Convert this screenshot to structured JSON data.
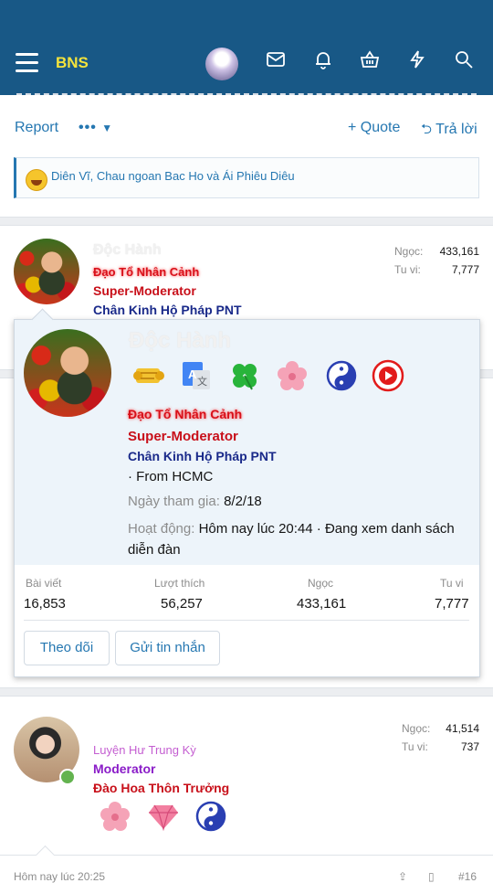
{
  "header": {
    "brand": "BNS",
    "icons": [
      "menu-icon",
      "avatar",
      "mail-icon",
      "bell-icon",
      "basket-icon",
      "bolt-icon",
      "search-icon"
    ]
  },
  "post_actions": {
    "report": "Report",
    "more": "•••",
    "quote": "+ Quote",
    "reply": "Trả lời"
  },
  "reactions": {
    "text": "Diên Vĩ, Chau ngoan Bac Ho và Ái Phiêu Diêu"
  },
  "post1": {
    "username": "Độc Hành",
    "title": "Đạo Tổ Nhân Cảnh",
    "role": "Super-Moderator",
    "group": "Chân Kinh Hộ Pháp PNT",
    "stats": [
      {
        "label": "Ngọc:",
        "value": "433,161"
      },
      {
        "label": "Tu vi:",
        "value": "7,777"
      }
    ]
  },
  "popup": {
    "username": "Độc Hành",
    "title": "Đạo Tổ Nhân Cảnh",
    "role": "Super-Moderator",
    "group": "Chân Kinh Hộ Pháp PNT",
    "location": "· From HCMC",
    "joined_label": "Ngày tham gia:",
    "joined_value": "8/2/18",
    "activity_label": "Hoạt động:",
    "activity_value": "Hôm nay lúc 20:44 · Đang xem danh sách diễn đàn",
    "trophies": [
      "scroll-icon",
      "translate-icon",
      "clover-icon",
      "cherry-blossom-icon",
      "yin-yang-icon",
      "youtube-icon"
    ],
    "stats": [
      {
        "label": "Bài viết",
        "value": "16,853"
      },
      {
        "label": "Lượt thích",
        "value": "56,257"
      },
      {
        "label": "Ngọc",
        "value": "433,161"
      },
      {
        "label": "Tu vi",
        "value": "7,777"
      }
    ],
    "follow_button": "Theo dõi",
    "message_button": "Gửi tin nhắn"
  },
  "post2": {
    "username": "Luyện Hư Trung Kỳ",
    "role": "Moderator",
    "group": "Đào Hoa Thôn Trưởng",
    "stats": [
      {
        "label": "Ngọc:",
        "value": "41,514"
      },
      {
        "label": "Tu vi:",
        "value": "737"
      }
    ],
    "trophies": [
      "cherry-blossom-icon",
      "diamond-icon",
      "yin-yang-icon"
    ],
    "timestamp": "Hôm nay lúc 20:25",
    "post_number": "#16"
  },
  "colors": {
    "header_bg": "#185886",
    "brand": "#f4e33c",
    "link": "#2577b1",
    "title_red": "#d8101a",
    "group_navy": "#1a2a8a",
    "mod_purple": "#8a1cc8"
  }
}
